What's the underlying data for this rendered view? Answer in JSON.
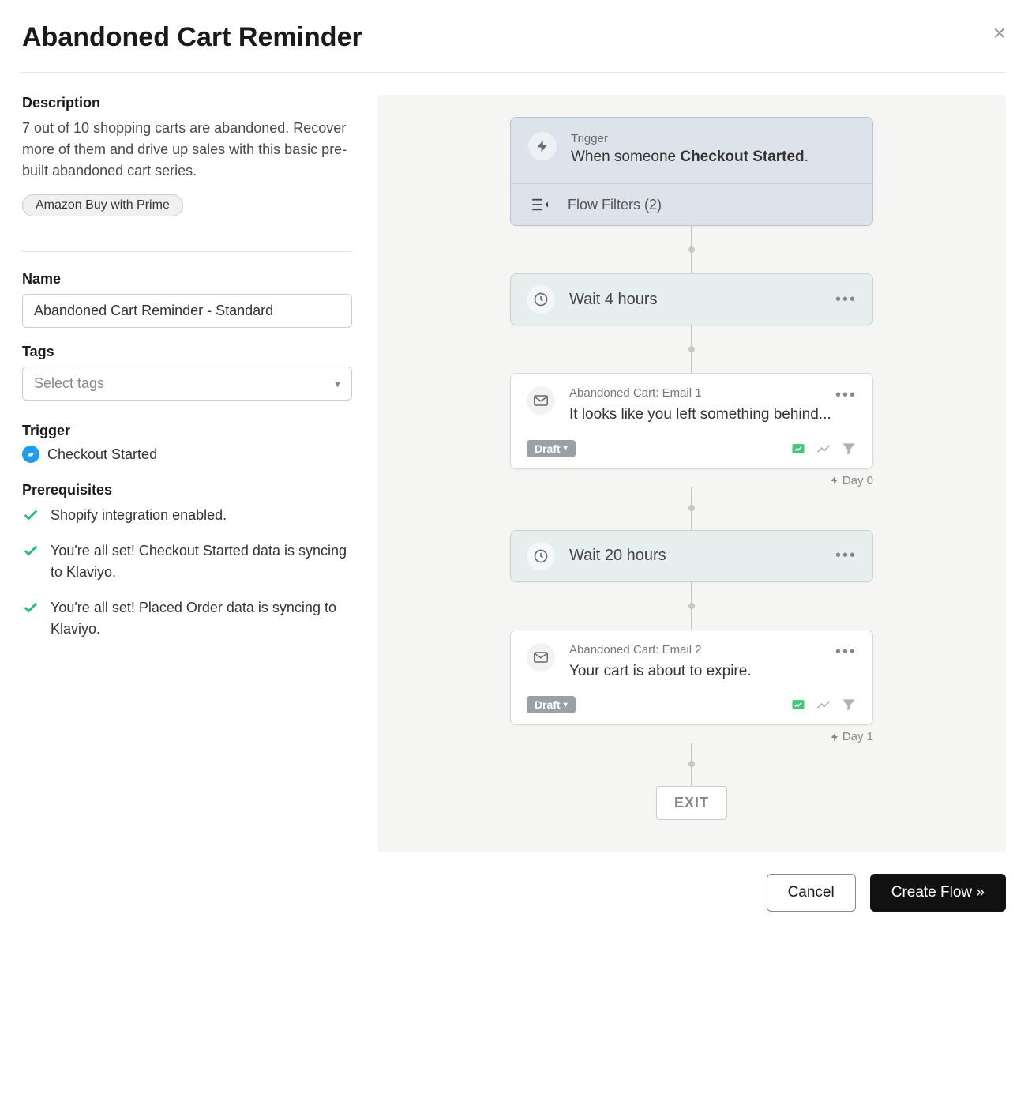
{
  "title": "Abandoned Cart Reminder",
  "sidebar": {
    "description_label": "Description",
    "description_text": "7 out of 10 shopping carts are abandoned. Recover more of them and drive up sales with this basic pre-built abandoned cart series.",
    "tag_pill": "Amazon Buy with Prime",
    "name_label": "Name",
    "name_value": "Abandoned Cart Reminder - Standard",
    "tags_label": "Tags",
    "tags_placeholder": "Select tags",
    "trigger_label": "Trigger",
    "trigger_value": "Checkout Started",
    "prerequisites_label": "Prerequisites",
    "prerequisites": [
      "Shopify integration enabled.",
      "You're all set! Checkout Started data is syncing to Klaviyo.",
      "You're all set! Placed Order data is syncing to Klaviyo."
    ]
  },
  "flow": {
    "trigger": {
      "label": "Trigger",
      "prefix": "When someone ",
      "event": "Checkout Started",
      "suffix": "."
    },
    "filters_label": "Flow Filters (2)",
    "wait1": "Wait 4 hours",
    "email1": {
      "name": "Abandoned Cart: Email 1",
      "subject": "It looks like you left something behind...",
      "status": "Draft"
    },
    "day0": "Day 0",
    "wait2": "Wait 20 hours",
    "email2": {
      "name": "Abandoned Cart: Email 2",
      "subject": "Your cart is about to expire.",
      "status": "Draft"
    },
    "day1": "Day 1",
    "exit": "EXIT"
  },
  "footer": {
    "cancel": "Cancel",
    "create": "Create Flow »"
  }
}
